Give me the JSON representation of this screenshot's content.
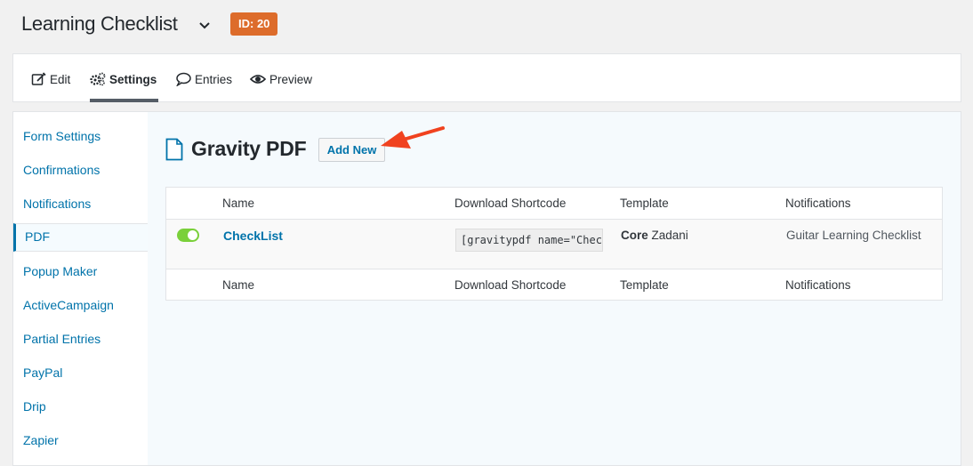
{
  "header": {
    "form_title": "Learning Checklist",
    "id_badge": "ID: 20"
  },
  "tabs": [
    {
      "label": "Edit",
      "icon": "edit-icon"
    },
    {
      "label": "Settings",
      "icon": "gears-icon",
      "active": true
    },
    {
      "label": "Entries",
      "icon": "comment-icon"
    },
    {
      "label": "Preview",
      "icon": "eye-icon"
    }
  ],
  "sidebar": {
    "items": [
      {
        "label": "Form Settings"
      },
      {
        "label": "Confirmations"
      },
      {
        "label": "Notifications"
      },
      {
        "label": "PDF",
        "active": true
      },
      {
        "label": "Popup Maker"
      },
      {
        "label": "ActiveCampaign"
      },
      {
        "label": "Partial Entries"
      },
      {
        "label": "PayPal"
      },
      {
        "label": "Drip"
      },
      {
        "label": "Zapier"
      }
    ]
  },
  "main": {
    "title": "Gravity PDF",
    "add_new_label": "Add New",
    "columns": [
      "Name",
      "Download Shortcode",
      "Template",
      "Notifications"
    ],
    "rows": [
      {
        "enabled": true,
        "name": "CheckList",
        "shortcode": "[gravitypdf name=\"CheckList\"",
        "template_group": "Core",
        "template_name": "Zadani",
        "notifications": "Guitar Learning Checklist"
      }
    ]
  },
  "colors": {
    "accent": "#0073aa",
    "badge": "#dd6c2b",
    "toggle_on": "#7ad03a",
    "arrow": "#f0421f"
  }
}
